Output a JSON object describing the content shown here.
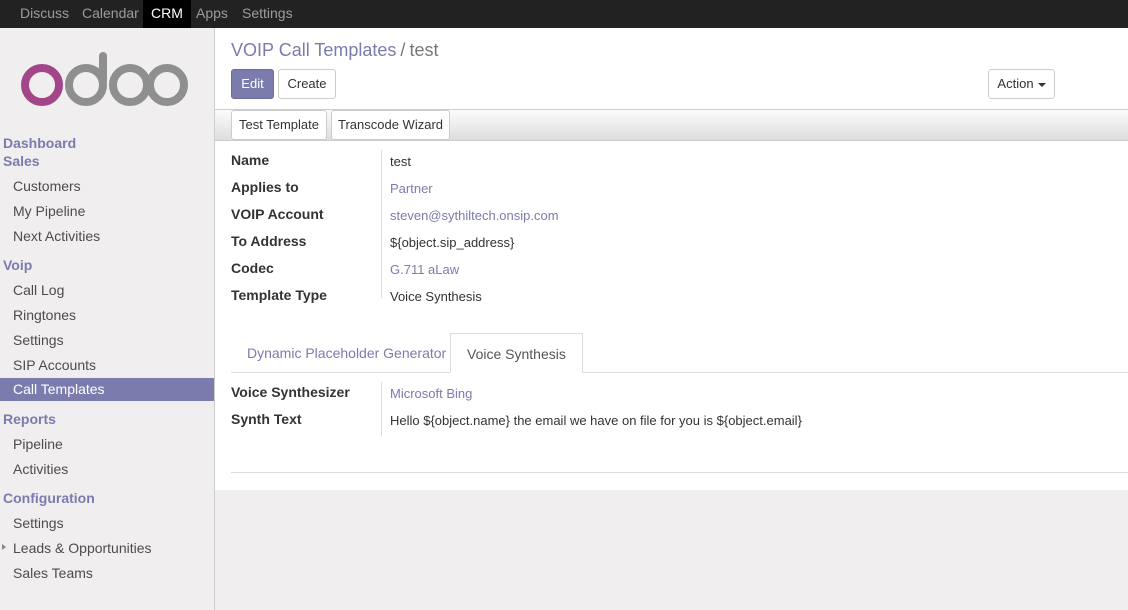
{
  "topbar": {
    "menus": [
      "Discuss",
      "Calendar",
      "CRM",
      "Apps",
      "Settings"
    ],
    "active_index": 2
  },
  "logo": {
    "text": "odoo",
    "colors": {
      "o1": "#a24689",
      "rest": "#8f8f8f"
    }
  },
  "sidebar": {
    "sections": [
      {
        "title": "Dashboard"
      },
      {
        "title": "Sales",
        "items": [
          "Customers",
          "My Pipeline",
          "Next Activities"
        ]
      },
      {
        "title": "Voip",
        "items": [
          "Call Log",
          "Ringtones",
          "Settings",
          "SIP Accounts",
          "Call Templates"
        ],
        "active_item": "Call Templates"
      },
      {
        "title": "Reports",
        "items": [
          "Pipeline",
          "Activities"
        ]
      },
      {
        "title": "Configuration",
        "items": [
          "Settings",
          "Leads & Opportunities",
          "Sales Teams"
        ]
      }
    ]
  },
  "breadcrumb": {
    "parent": "VOIP Call Templates",
    "separator": "/",
    "current": "test"
  },
  "buttons": {
    "edit": "Edit",
    "create": "Create",
    "action": "Action"
  },
  "statusbar_buttons": [
    "Test Template",
    "Transcode Wizard"
  ],
  "fields": [
    {
      "label": "Name",
      "value": "test",
      "link": false
    },
    {
      "label": "Applies to",
      "value": "Partner",
      "link": true
    },
    {
      "label": "VOIP Account",
      "value": "steven@sythiltech.onsip.com",
      "link": true
    },
    {
      "label": "To Address",
      "value": "${object.sip_address}",
      "link": false
    },
    {
      "label": "Codec",
      "value": "G.711 aLaw",
      "link": true
    },
    {
      "label": "Template Type",
      "value": "Voice Synthesis",
      "link": false
    }
  ],
  "tabs": [
    {
      "label": "Dynamic Placeholder Generator",
      "active": false
    },
    {
      "label": "Voice Synthesis",
      "active": true
    }
  ],
  "tab_fields": [
    {
      "label": "Voice Synthesizer",
      "value": "Microsoft Bing",
      "link": true
    },
    {
      "label": "Synth Text",
      "value": "Hello ${object.name} the email we have on file for you is ${object.email}",
      "link": false
    }
  ],
  "colors": {
    "accent": "#7c7bad",
    "topbar": "#222222",
    "sidebar_bg": "#f0eeee"
  }
}
